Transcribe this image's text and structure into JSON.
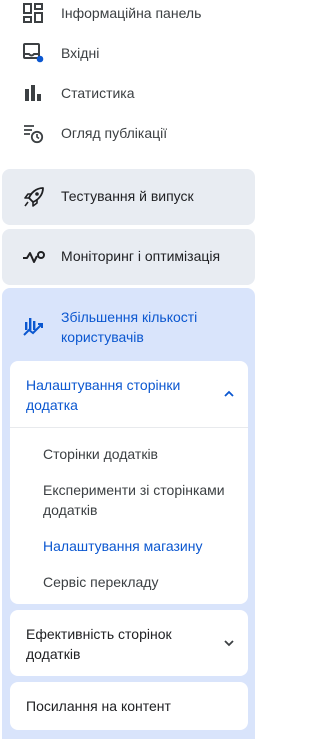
{
  "nav": {
    "items": [
      {
        "label": "Інформаційна панель",
        "icon": "dashboard-icon"
      },
      {
        "label": "Вхідні",
        "icon": "inbox-icon"
      },
      {
        "label": "Статистика",
        "icon": "bar-chart-icon"
      },
      {
        "label": "Огляд публікації",
        "icon": "publishing-overview-icon"
      }
    ],
    "sections": [
      {
        "label": "Тестування й випуск",
        "icon": "rocket-icon"
      },
      {
        "label": "Моніторинг і оптимізація",
        "icon": "monitoring-icon"
      }
    ]
  },
  "growth": {
    "label": "Збільшення кількості користувачів",
    "icon": "growth-icon",
    "store_presence": {
      "header": "Налаштування сторінки додатка",
      "expanded": true,
      "items": [
        {
          "label": "Сторінки додатків"
        },
        {
          "label": "Експерименти зі сторінками додатків"
        },
        {
          "label": "Налаштування магазину",
          "selected": true
        },
        {
          "label": "Сервіс перекладу"
        }
      ]
    },
    "store_performance": {
      "header": "Ефективність сторінок додатків",
      "expanded": false
    },
    "deep_links": {
      "header": "Посилання на контент"
    }
  },
  "colors": {
    "accent": "#0b57d0",
    "section_bg": "#e8ecf2",
    "growth_bg": "#d9e4fb",
    "badge_dot": "#0b57d0"
  }
}
